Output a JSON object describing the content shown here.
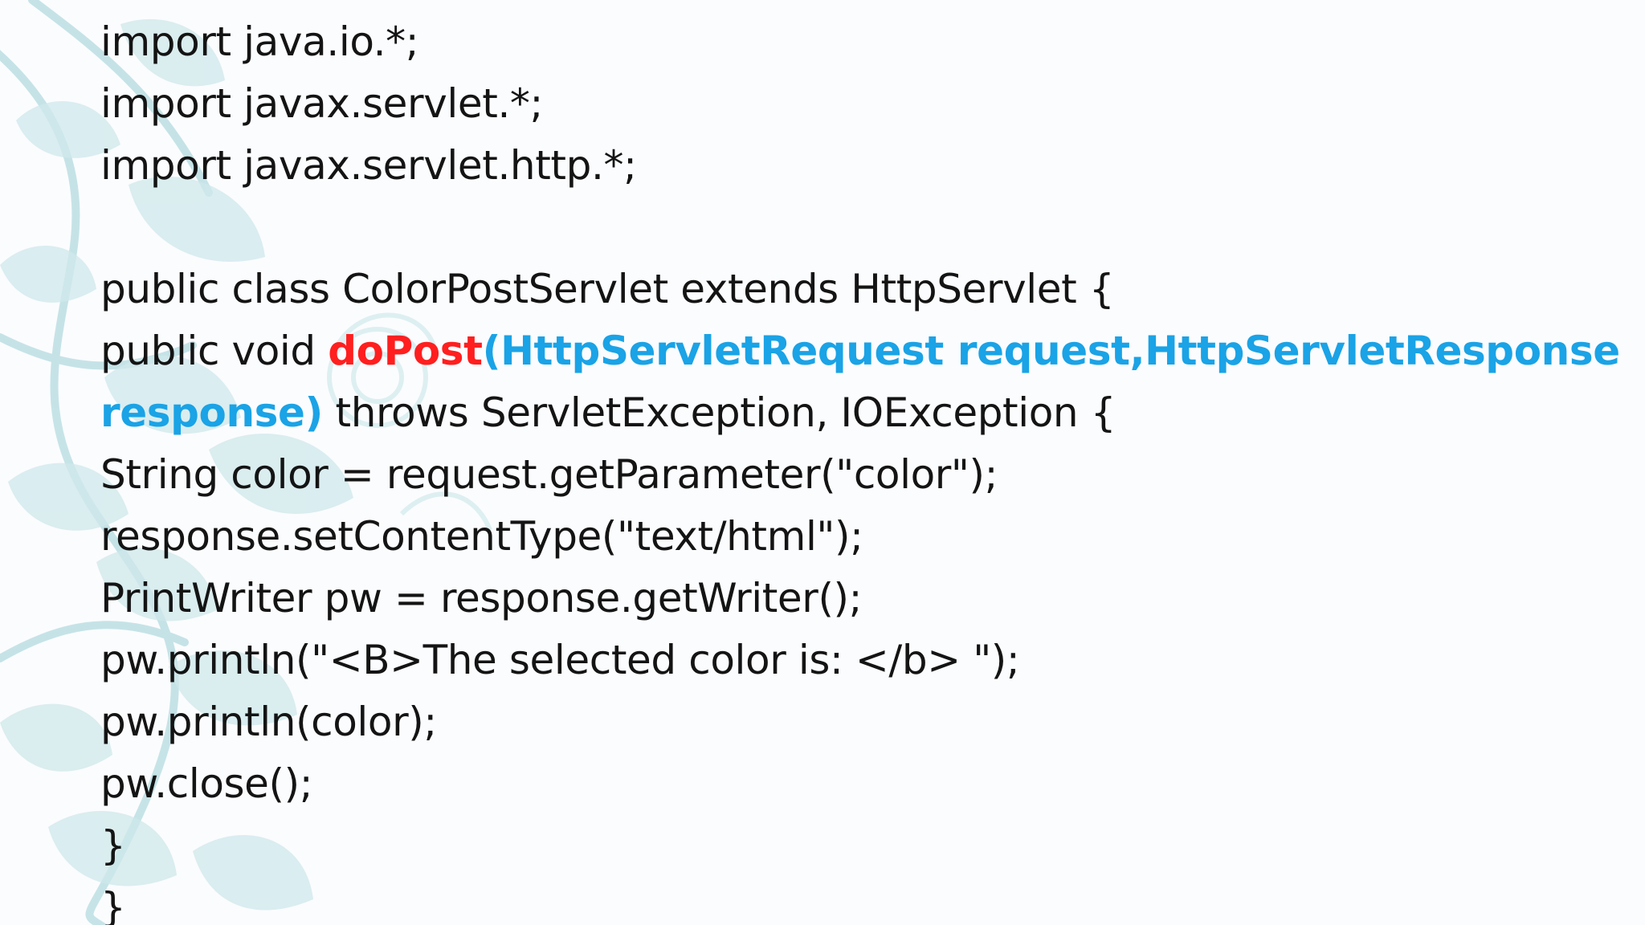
{
  "colors": {
    "background": "#fbfcfe",
    "text": "#141414",
    "method_highlight": "#ff1f1f",
    "param_highlight": "#1aa3e6",
    "floral": "#bcdfe3"
  },
  "decoration": {
    "icon": "floral-pattern-icon"
  },
  "code": {
    "line1": "import java.io.*;",
    "line2": "import javax.servlet.*;",
    "line3": "import javax.servlet.http.*;",
    "line4": "",
    "line5": "public class ColorPostServlet extends HttpServlet {",
    "line6": {
      "prefix": "public void ",
      "method": "doPost",
      "params": "(HttpServletRequest request,HttpServletResponse"
    },
    "line7": {
      "params_end": "response)",
      "rest": " throws ServletException, IOException {"
    },
    "line8": "String color = request.getParameter(\"color\");",
    "line9": "response.setContentType(\"text/html\");",
    "line10": "PrintWriter pw = response.getWriter();",
    "line11": "pw.println(\"<B>The selected color is: </b> \");",
    "line12": "pw.println(color);",
    "line13": "pw.close();",
    "line14": "}",
    "line15": "}"
  }
}
